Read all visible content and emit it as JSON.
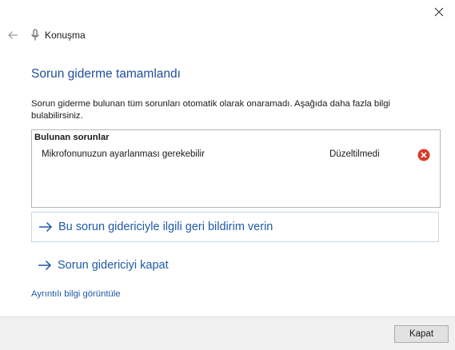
{
  "window": {
    "close_icon": "close-icon"
  },
  "header": {
    "back_icon": "back-arrow-icon",
    "app_icon": "microphone-icon",
    "title": "Konuşma"
  },
  "main": {
    "title": "Sorun giderme tamamlandı",
    "description": "Sorun giderme bulunan tüm sorunları otomatik olarak onaramadı. Aşağıda daha fazla bilgi bulabilirsiniz."
  },
  "problems": {
    "header": "Bulunan sorunlar",
    "items": [
      {
        "name": "Mikrofonunuzun ayarlanması gerekebilir",
        "status": "Düzeltilmedi",
        "status_icon": "error-icon"
      }
    ]
  },
  "actions": {
    "feedback_label": "Bu sorun gidericiyle ilgili geri bildirim verin",
    "close_troubleshooter_label": "Sorun gidericiyi kapat",
    "details_link_label": "Ayrıntılı bilgi görüntüle"
  },
  "footer": {
    "close_button_label": "Kapat"
  },
  "colors": {
    "title": "#1f4e9c",
    "link": "#1e5aa8",
    "error": "#d93b2b",
    "footer_bg": "#f0f0f0"
  }
}
